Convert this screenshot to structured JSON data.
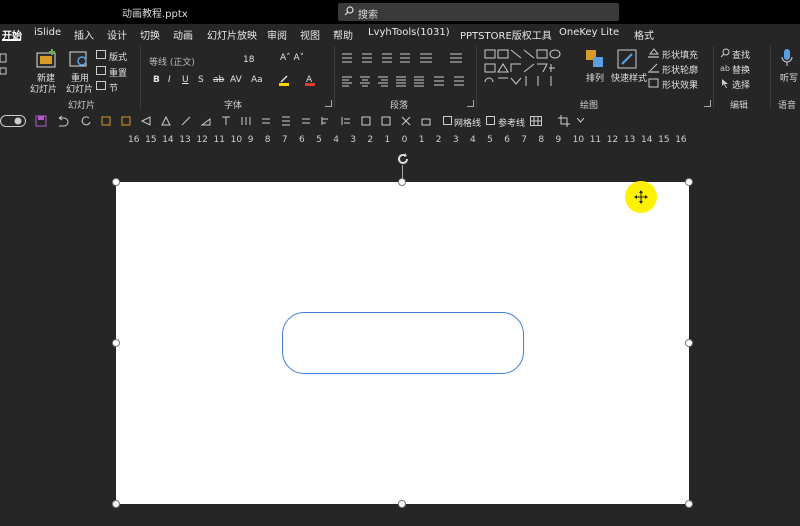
{
  "window": {
    "title": "动画教程.pptx"
  },
  "search": {
    "label": "搜索"
  },
  "tabs": [
    "开始",
    "iSlide",
    "插入",
    "设计",
    "切换",
    "动画",
    "幻灯片放映",
    "审阅",
    "视图",
    "帮助",
    "LvyhTools(1031)",
    "PPTSTORE版权工具",
    "OneKey Lite",
    "格式"
  ],
  "ribbon": {
    "slides": {
      "new_label1": "新建",
      "new_label2": "幻灯片",
      "reuse_label1": "重用",
      "reuse_label2": "幻灯片",
      "layout": "版式",
      "reset": "重置",
      "section": "节",
      "group": "幻灯片"
    },
    "font": {
      "name": "等线 (正文)",
      "size": "18",
      "group": "字体"
    },
    "paragraph": {
      "group": "段落"
    },
    "drawing": {
      "arrange": "排列",
      "quickstyle": "快速样式",
      "fill": "形状填充",
      "outline": "形状轮廓",
      "effect": "形状效果",
      "group": "绘图"
    },
    "editing": {
      "find": "查找",
      "replace": "替换",
      "select": "选择",
      "group": "编辑"
    },
    "voice": {
      "dictate": "听写",
      "group": "语音"
    }
  },
  "qat": {
    "gridlines": "网格线",
    "guides": "参考线"
  },
  "ruler": {
    "ticks": [
      "16",
      "15",
      "14",
      "13",
      "12",
      "11",
      "10",
      "9",
      "8",
      "7",
      "6",
      "5",
      "4",
      "3",
      "2",
      "1",
      "0",
      "1",
      "2",
      "3",
      "4",
      "5",
      "6",
      "7",
      "8",
      "9",
      "10",
      "11",
      "12",
      "13",
      "14",
      "15",
      "16"
    ]
  },
  "colors": {
    "accent": "#3f7fd6",
    "highlight": "#fff200",
    "font_color": "#e03b3b",
    "highlight_color": "#ffd400"
  }
}
